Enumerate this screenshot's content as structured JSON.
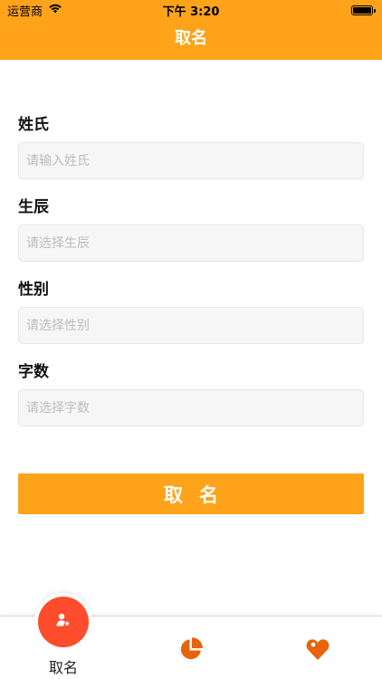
{
  "theme": {
    "accent": "#FFA31A",
    "tab_active": "#FF4C2C",
    "icon_orange": "#E8630A"
  },
  "status_bar": {
    "carrier": "运营商",
    "time": "下午 3:20"
  },
  "nav": {
    "title": "取名"
  },
  "form": {
    "fields": [
      {
        "label": "姓氏",
        "placeholder": "请输入姓氏"
      },
      {
        "label": "生辰",
        "placeholder": "请选择生辰"
      },
      {
        "label": "性别",
        "placeholder": "请选择性别"
      },
      {
        "label": "字数",
        "placeholder": "请选择字数"
      }
    ],
    "submit_label": "取名"
  },
  "tabbar": {
    "items": [
      {
        "label": "取名",
        "icon": "person-star-icon",
        "active": true
      },
      {
        "label": "",
        "icon": "pie-chart-icon",
        "active": false
      },
      {
        "label": "",
        "icon": "heart-tag-icon",
        "active": false
      }
    ]
  }
}
